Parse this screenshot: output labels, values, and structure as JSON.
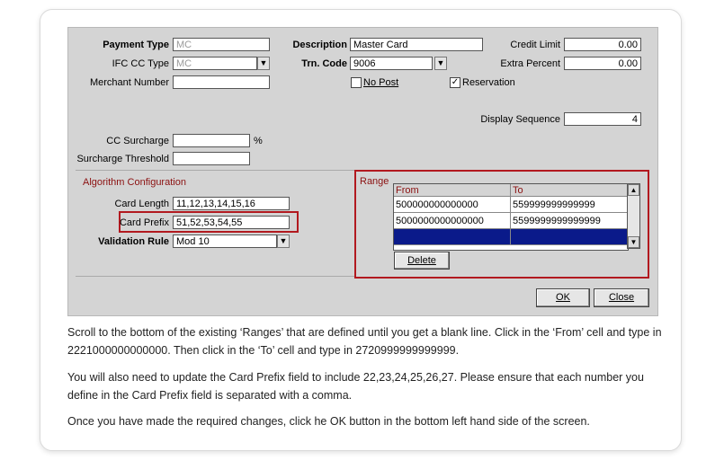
{
  "form": {
    "payment_type_label": "Payment Type",
    "payment_type_value": "MC",
    "ifc_cc_type_label": "IFC CC Type",
    "ifc_cc_type_value": "MC",
    "merchant_number_label": "Merchant Number",
    "merchant_number_value": "",
    "description_label": "Description",
    "description_value": "Master Card",
    "trn_code_label": "Trn. Code",
    "trn_code_value": "9006",
    "no_post_label": "No Post",
    "no_post_checked": false,
    "reservation_label": "Reservation",
    "reservation_checked": true,
    "credit_limit_label": "Credit Limit",
    "credit_limit_value": "0.00",
    "extra_percent_label": "Extra Percent",
    "extra_percent_value": "0.00",
    "display_sequence_label": "Display Sequence",
    "display_sequence_value": "4",
    "cc_surcharge_label": "CC Surcharge",
    "cc_surcharge_value": "",
    "percent_sign": "%",
    "surcharge_threshold_label": "Surcharge Threshold",
    "surcharge_threshold_value": ""
  },
  "algorithm": {
    "section_title": "Algorithm Configuration",
    "card_length_label": "Card Length",
    "card_length_value": "11,12,13,14,15,16",
    "card_prefix_label": "Card Prefix",
    "card_prefix_value": "51,52,53,54,55",
    "validation_rule_label": "Validation Rule",
    "validation_rule_value": "Mod 10"
  },
  "range": {
    "section_title": "Range",
    "columns": [
      "From",
      "To"
    ],
    "rows": [
      {
        "from": "500000000000000",
        "to": "559999999999999"
      },
      {
        "from": "5000000000000000",
        "to": "5599999999999999"
      },
      {
        "from": "",
        "to": ""
      }
    ],
    "delete_label": "Delete"
  },
  "buttons": {
    "ok_label": "OK",
    "close_label": "Close"
  },
  "instructions": [
    "Scroll to the bottom of the existing ‘Ranges’ that are defined until you get a blank line. Click in the ‘From’ cell and type in 2221000000000000. Then click in the ‘To’ cell and type in 2720999999999999.",
    "You will also need to update the Card Prefix field to include 22,23,24,25,26,27. Please ensure that each number you define in the Card Prefix field is separated with a comma.",
    "Once you have made the required changes, click he OK button in the bottom left hand side of the screen."
  ],
  "colors": {
    "highlight": "#b2191f",
    "section_title": "#8b1010",
    "selected_row": "#0a1a8a"
  }
}
